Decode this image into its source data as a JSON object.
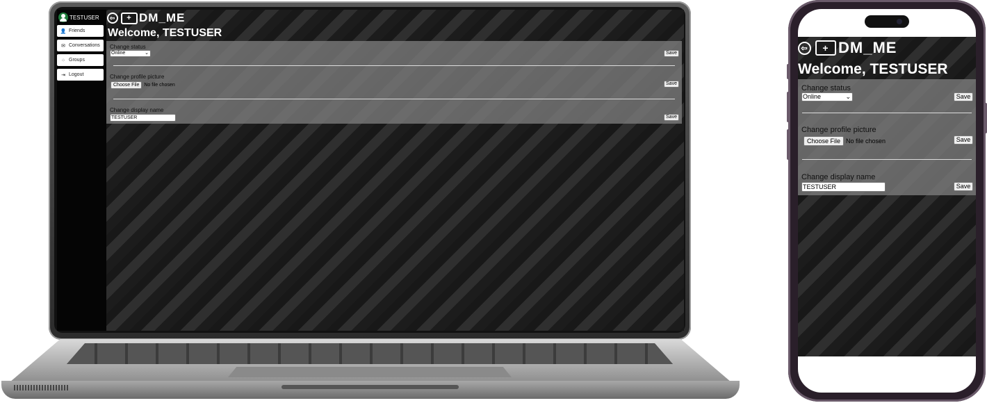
{
  "app": {
    "logo_text": "DM_ME",
    "welcome": "Welcome, TESTUSER"
  },
  "user": {
    "name": "TESTUSER"
  },
  "sidebar": {
    "items": [
      {
        "label": "Friends",
        "icon": "person-icon"
      },
      {
        "label": "Conversations",
        "icon": "envelope-icon"
      },
      {
        "label": "Groups",
        "icon": "group-icon"
      },
      {
        "label": "Logout",
        "icon": "logout-icon"
      }
    ]
  },
  "settings": {
    "status": {
      "label": "Change status",
      "value": "Online",
      "save_label": "Save"
    },
    "picture": {
      "label": "Change profile picture",
      "button": "Choose File",
      "file_text": "No file chosen",
      "save_label": "Save"
    },
    "display_name": {
      "label": "Change display name",
      "value": "TESTUSER",
      "save_label": "Save"
    }
  }
}
